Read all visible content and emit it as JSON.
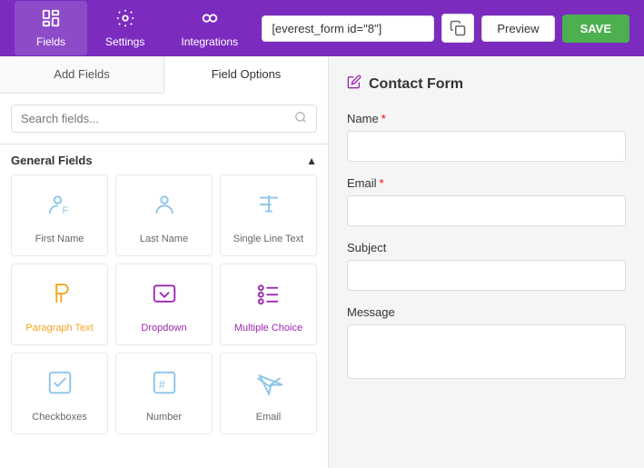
{
  "nav": {
    "items": [
      {
        "id": "fields",
        "label": "Fields",
        "active": true
      },
      {
        "id": "settings",
        "label": "Settings",
        "active": false
      },
      {
        "id": "integrations",
        "label": "Integrations",
        "active": false
      }
    ],
    "shortcode": "[everest_form id=\"8\"]",
    "preview_label": "Preview",
    "save_label": "SAVE"
  },
  "left_panel": {
    "tabs": [
      {
        "id": "add-fields",
        "label": "Add Fields",
        "active": false
      },
      {
        "id": "field-options",
        "label": "Field Options",
        "active": true
      }
    ],
    "search_placeholder": "Search fields...",
    "section_title": "General Fields",
    "fields": [
      {
        "id": "first-name",
        "label": "First Name",
        "color": "blue",
        "icon": "user-f"
      },
      {
        "id": "last-name",
        "label": "Last Name",
        "color": "blue",
        "icon": "user"
      },
      {
        "id": "single-line",
        "label": "Single Line Text",
        "color": "blue",
        "icon": "text-t"
      },
      {
        "id": "paragraph",
        "label": "Paragraph Text",
        "color": "orange",
        "icon": "paragraph"
      },
      {
        "id": "dropdown",
        "label": "Dropdown",
        "color": "purple",
        "icon": "dropdown"
      },
      {
        "id": "multiple-choice",
        "label": "Multiple Choice",
        "color": "purple",
        "icon": "multiple-choice"
      },
      {
        "id": "checkboxes",
        "label": "Checkboxes",
        "color": "blue",
        "icon": "checkboxes"
      },
      {
        "id": "number",
        "label": "Number",
        "color": "blue",
        "icon": "number"
      },
      {
        "id": "email",
        "label": "Email",
        "color": "blue",
        "icon": "email"
      }
    ]
  },
  "right_panel": {
    "form_title": "Contact Form",
    "fields": [
      {
        "id": "name",
        "label": "Name",
        "required": true,
        "type": "input"
      },
      {
        "id": "email",
        "label": "Email",
        "required": true,
        "type": "input"
      },
      {
        "id": "subject",
        "label": "Subject",
        "required": false,
        "type": "input"
      },
      {
        "id": "message",
        "label": "Message",
        "required": false,
        "type": "textarea"
      }
    ]
  }
}
